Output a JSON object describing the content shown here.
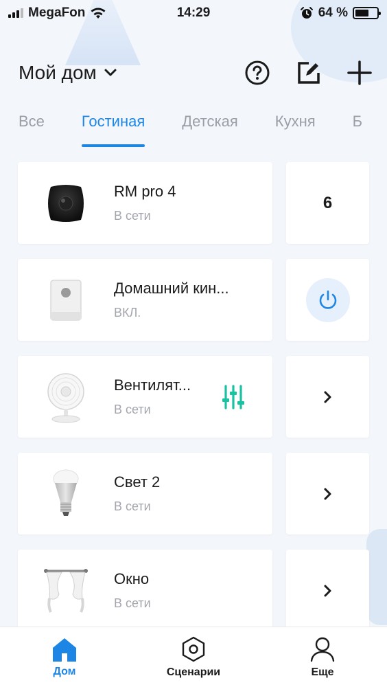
{
  "status_bar": {
    "carrier": "MegaFon",
    "time": "14:29",
    "battery_percent": "64 %",
    "battery_level": 0.64
  },
  "header": {
    "title": "Мой дом",
    "icons": [
      "chevron-down-icon",
      "help-icon",
      "edit-icon",
      "plus-icon"
    ]
  },
  "tabs": [
    {
      "label": "Все",
      "active": false
    },
    {
      "label": "Гостиная",
      "active": true
    },
    {
      "label": "Детская",
      "active": false
    },
    {
      "label": "Кухня",
      "active": false
    },
    {
      "label": "Б",
      "active": false
    }
  ],
  "devices": [
    {
      "name": "RM pro 4",
      "status": "В сети",
      "image": "remote-hub-icon",
      "action": "count",
      "action_value": "6"
    },
    {
      "name": "Домашний кин...",
      "status": "ВКЛ.",
      "image": "smart-plug-icon",
      "action": "power",
      "accent": "#1d86e5"
    },
    {
      "name": "Вентилят...",
      "status": "В сети",
      "image": "fan-icon",
      "action": "chevron",
      "extra_icon": "sliders-icon",
      "extra_color": "#19c2a0"
    },
    {
      "name": "Свет 2",
      "status": "В сети",
      "image": "bulb-icon",
      "action": "chevron"
    },
    {
      "name": "Окно",
      "status": "В сети",
      "image": "curtain-icon",
      "action": "chevron"
    }
  ],
  "bottom_nav": [
    {
      "label": "Дом",
      "icon": "home-icon",
      "active": true
    },
    {
      "label": "Сценарии",
      "icon": "scenes-icon",
      "active": false
    },
    {
      "label": "Еще",
      "icon": "profile-icon",
      "active": false
    }
  ],
  "colors": {
    "accent": "#1d86e5",
    "teal": "#19c2a0",
    "background": "#f3f6fb"
  }
}
